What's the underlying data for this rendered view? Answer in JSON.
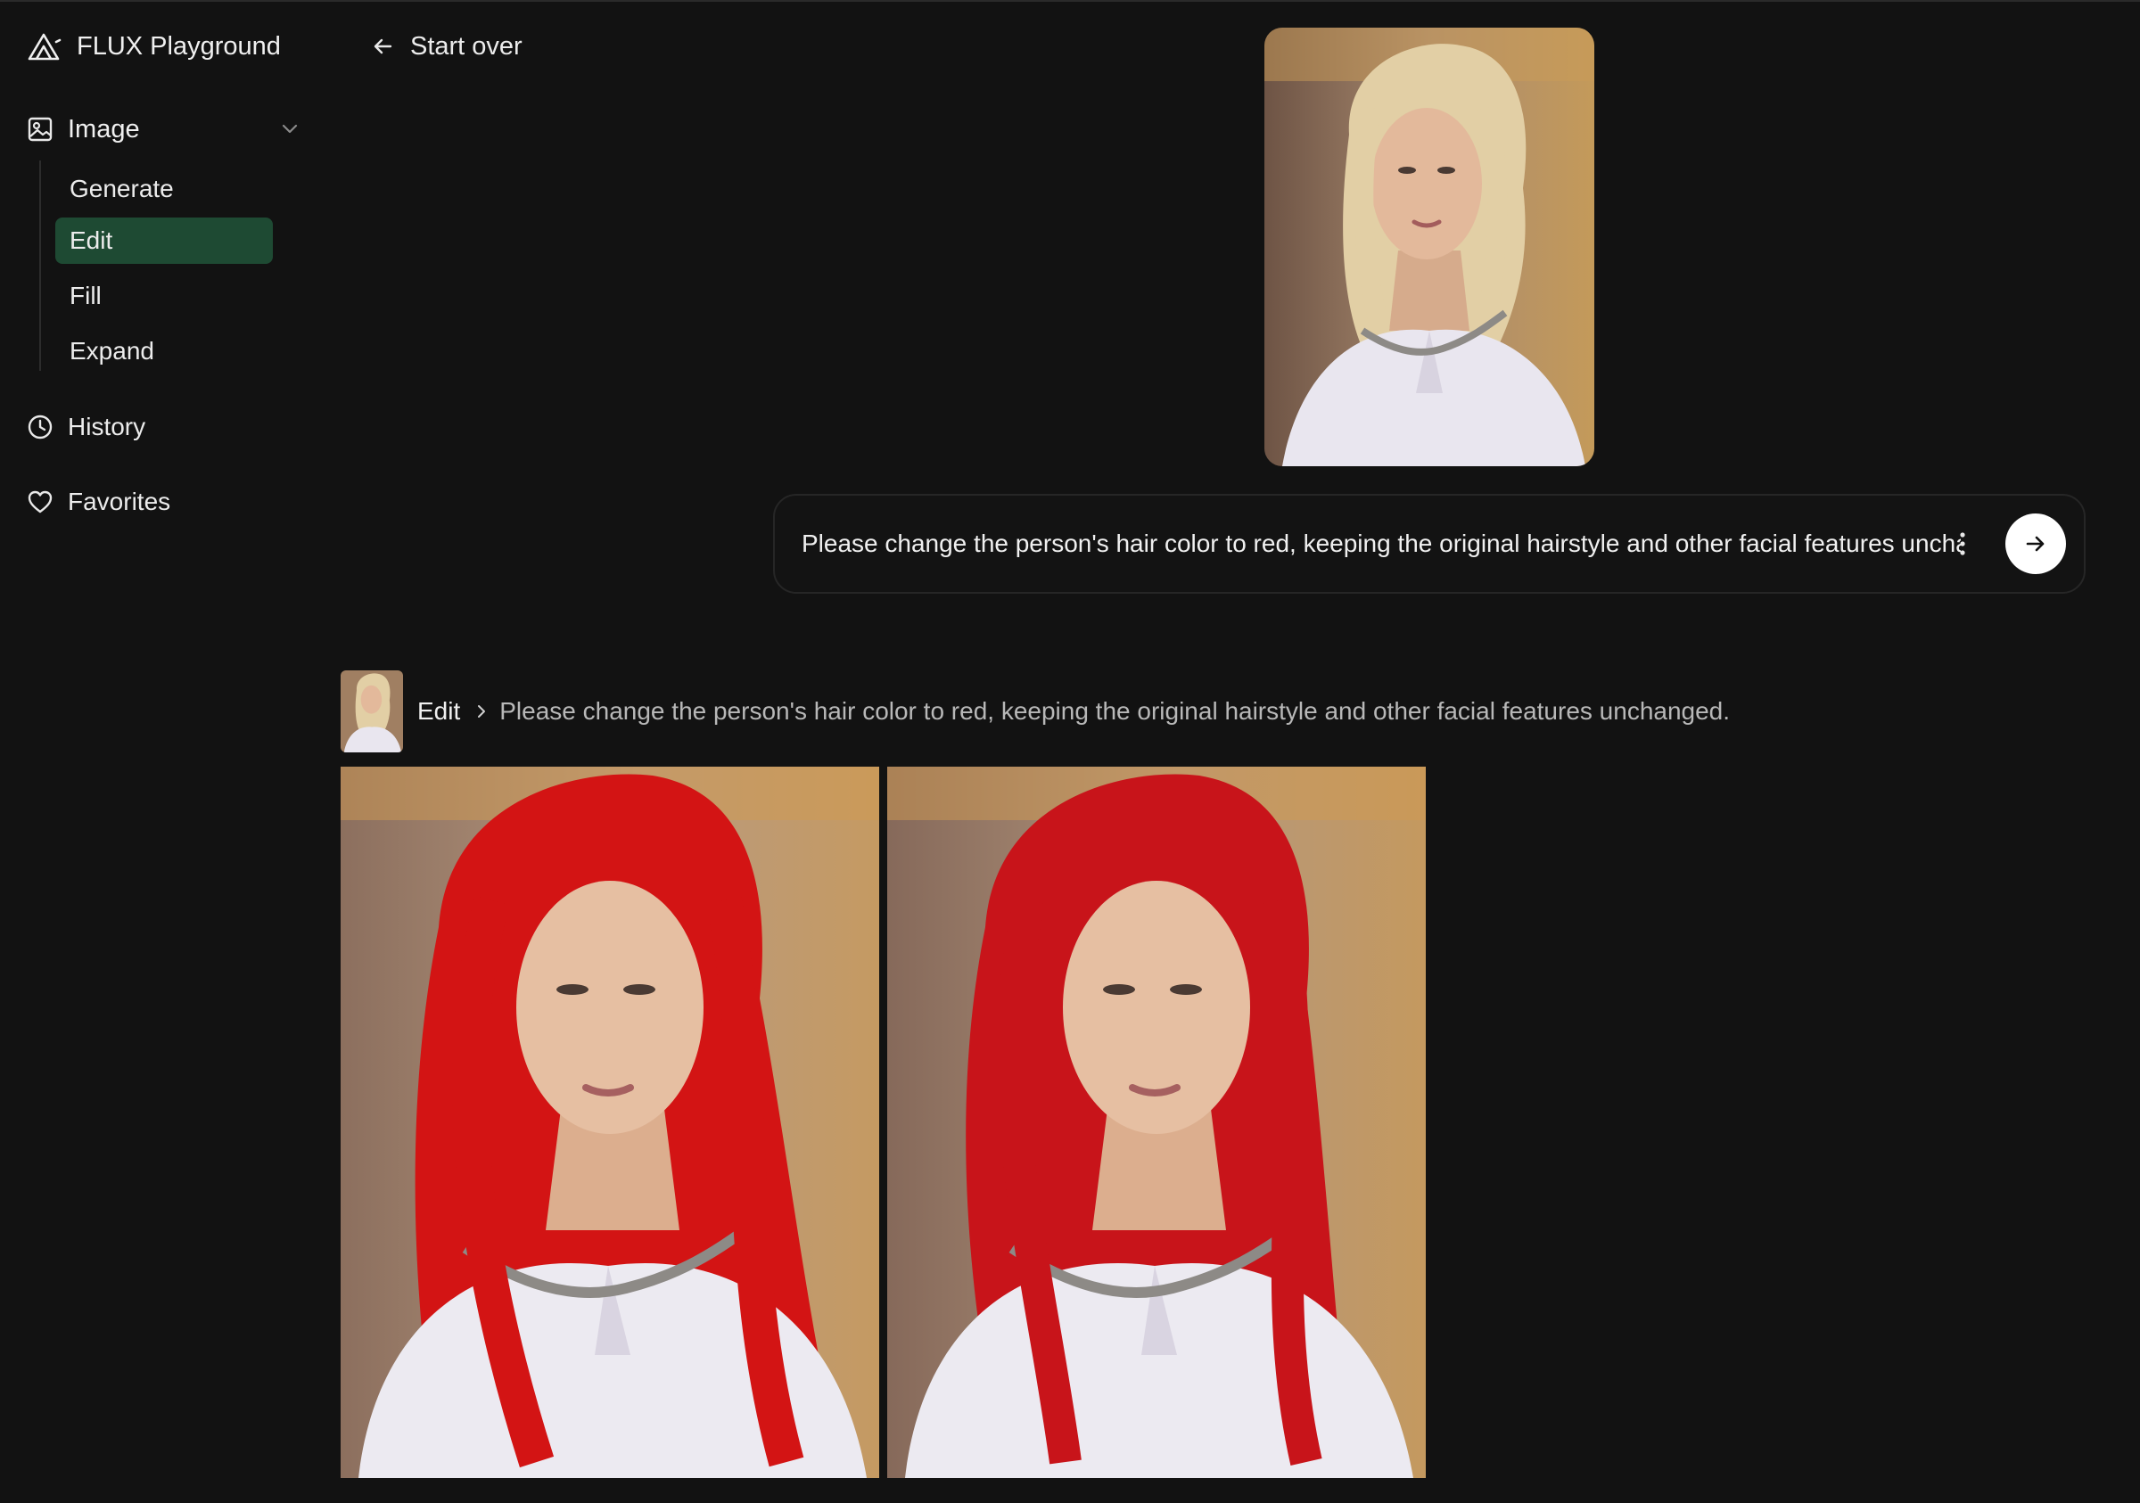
{
  "app": {
    "name": "FLUX Playground"
  },
  "sidebar": {
    "section": {
      "label": "Image",
      "icon": "image-icon",
      "expanded": true
    },
    "subitems": [
      {
        "label": "Generate",
        "active": false
      },
      {
        "label": "Edit",
        "active": true
      },
      {
        "label": "Fill",
        "active": false
      },
      {
        "label": "Expand",
        "active": false
      }
    ],
    "links": [
      {
        "label": "History",
        "icon": "clock-icon"
      },
      {
        "label": "Favorites",
        "icon": "heart-icon"
      }
    ]
  },
  "main": {
    "start_over_label": "Start over",
    "source_image": {
      "alt": "Source portrait",
      "hair_color": "#e2cfa5"
    },
    "prompt": {
      "text": "Please change the person's hair color to red, keeping the original hairstyle and other facial features unchang"
    },
    "result": {
      "mode_label": "Edit",
      "prompt_text": "Please change the person's hair color to red, keeping the original hairstyle and other facial features unchanged.",
      "images": [
        {
          "alt": "Edited result 1",
          "hair_color": "#d31414"
        },
        {
          "alt": "Edited result 2",
          "hair_color": "#c8141a"
        }
      ]
    }
  },
  "colors": {
    "background": "#121212",
    "active_item": "#1e4a33",
    "text": "#ececec",
    "muted_text": "#b8b8b8"
  }
}
